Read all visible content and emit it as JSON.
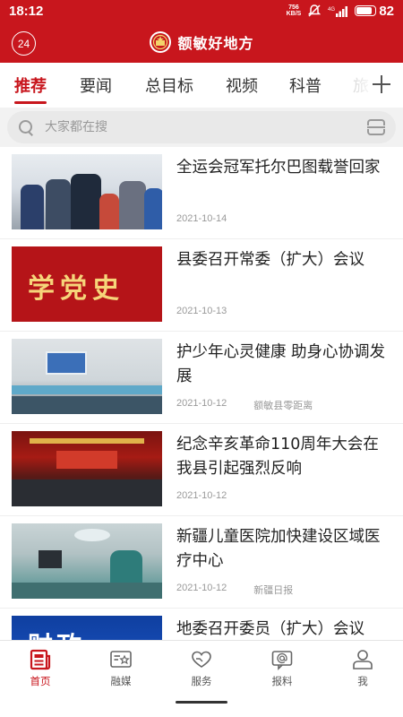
{
  "status_bar": {
    "time": "18:12",
    "net_speed_value": "756",
    "net_speed_unit": "KB/S",
    "network": "4G",
    "battery": "82"
  },
  "header": {
    "left_badge": "24",
    "title": "额敏好地方"
  },
  "tabs": [
    {
      "label": "推荐",
      "active": true
    },
    {
      "label": "要闻",
      "active": false
    },
    {
      "label": "总目标",
      "active": false
    },
    {
      "label": "视频",
      "active": false
    },
    {
      "label": "科普",
      "active": false
    },
    {
      "label": "旅",
      "active": false
    }
  ],
  "search": {
    "placeholder": "大家都在搜"
  },
  "news": [
    {
      "title": "全运会冠军托尔巴图载誉回家",
      "date": "2021-10-14",
      "source": ""
    },
    {
      "title": "县委召开常委（扩大）会议",
      "date": "2021-10-13",
      "source": "",
      "thumb_text": "学党史"
    },
    {
      "title": "护少年心灵健康 助身心协调发展",
      "date": "2021-10-12",
      "source": "额敏县零距离"
    },
    {
      "title": "纪念辛亥革命110周年大会在我县引起强烈反响",
      "date": "2021-10-12",
      "source": ""
    },
    {
      "title": "新疆儿童医院加快建设区域医疗中心",
      "date": "2021-10-12",
      "source": "新疆日报"
    },
    {
      "title": "地委召开委员（扩大）会议",
      "date": "",
      "source": "",
      "thumb_text": "财政"
    }
  ],
  "bottom_nav": [
    {
      "label": "首页",
      "icon": "newspaper-icon",
      "active": true
    },
    {
      "label": "融媒",
      "icon": "media-card-icon",
      "active": false
    },
    {
      "label": "服务",
      "icon": "heart-hands-icon",
      "active": false
    },
    {
      "label": "报料",
      "icon": "at-message-icon",
      "active": false
    },
    {
      "label": "我",
      "icon": "person-icon",
      "active": false
    }
  ],
  "colors": {
    "brand_red": "#c8161d",
    "inactive_text": "#555555",
    "meta_gray": "#999999"
  }
}
